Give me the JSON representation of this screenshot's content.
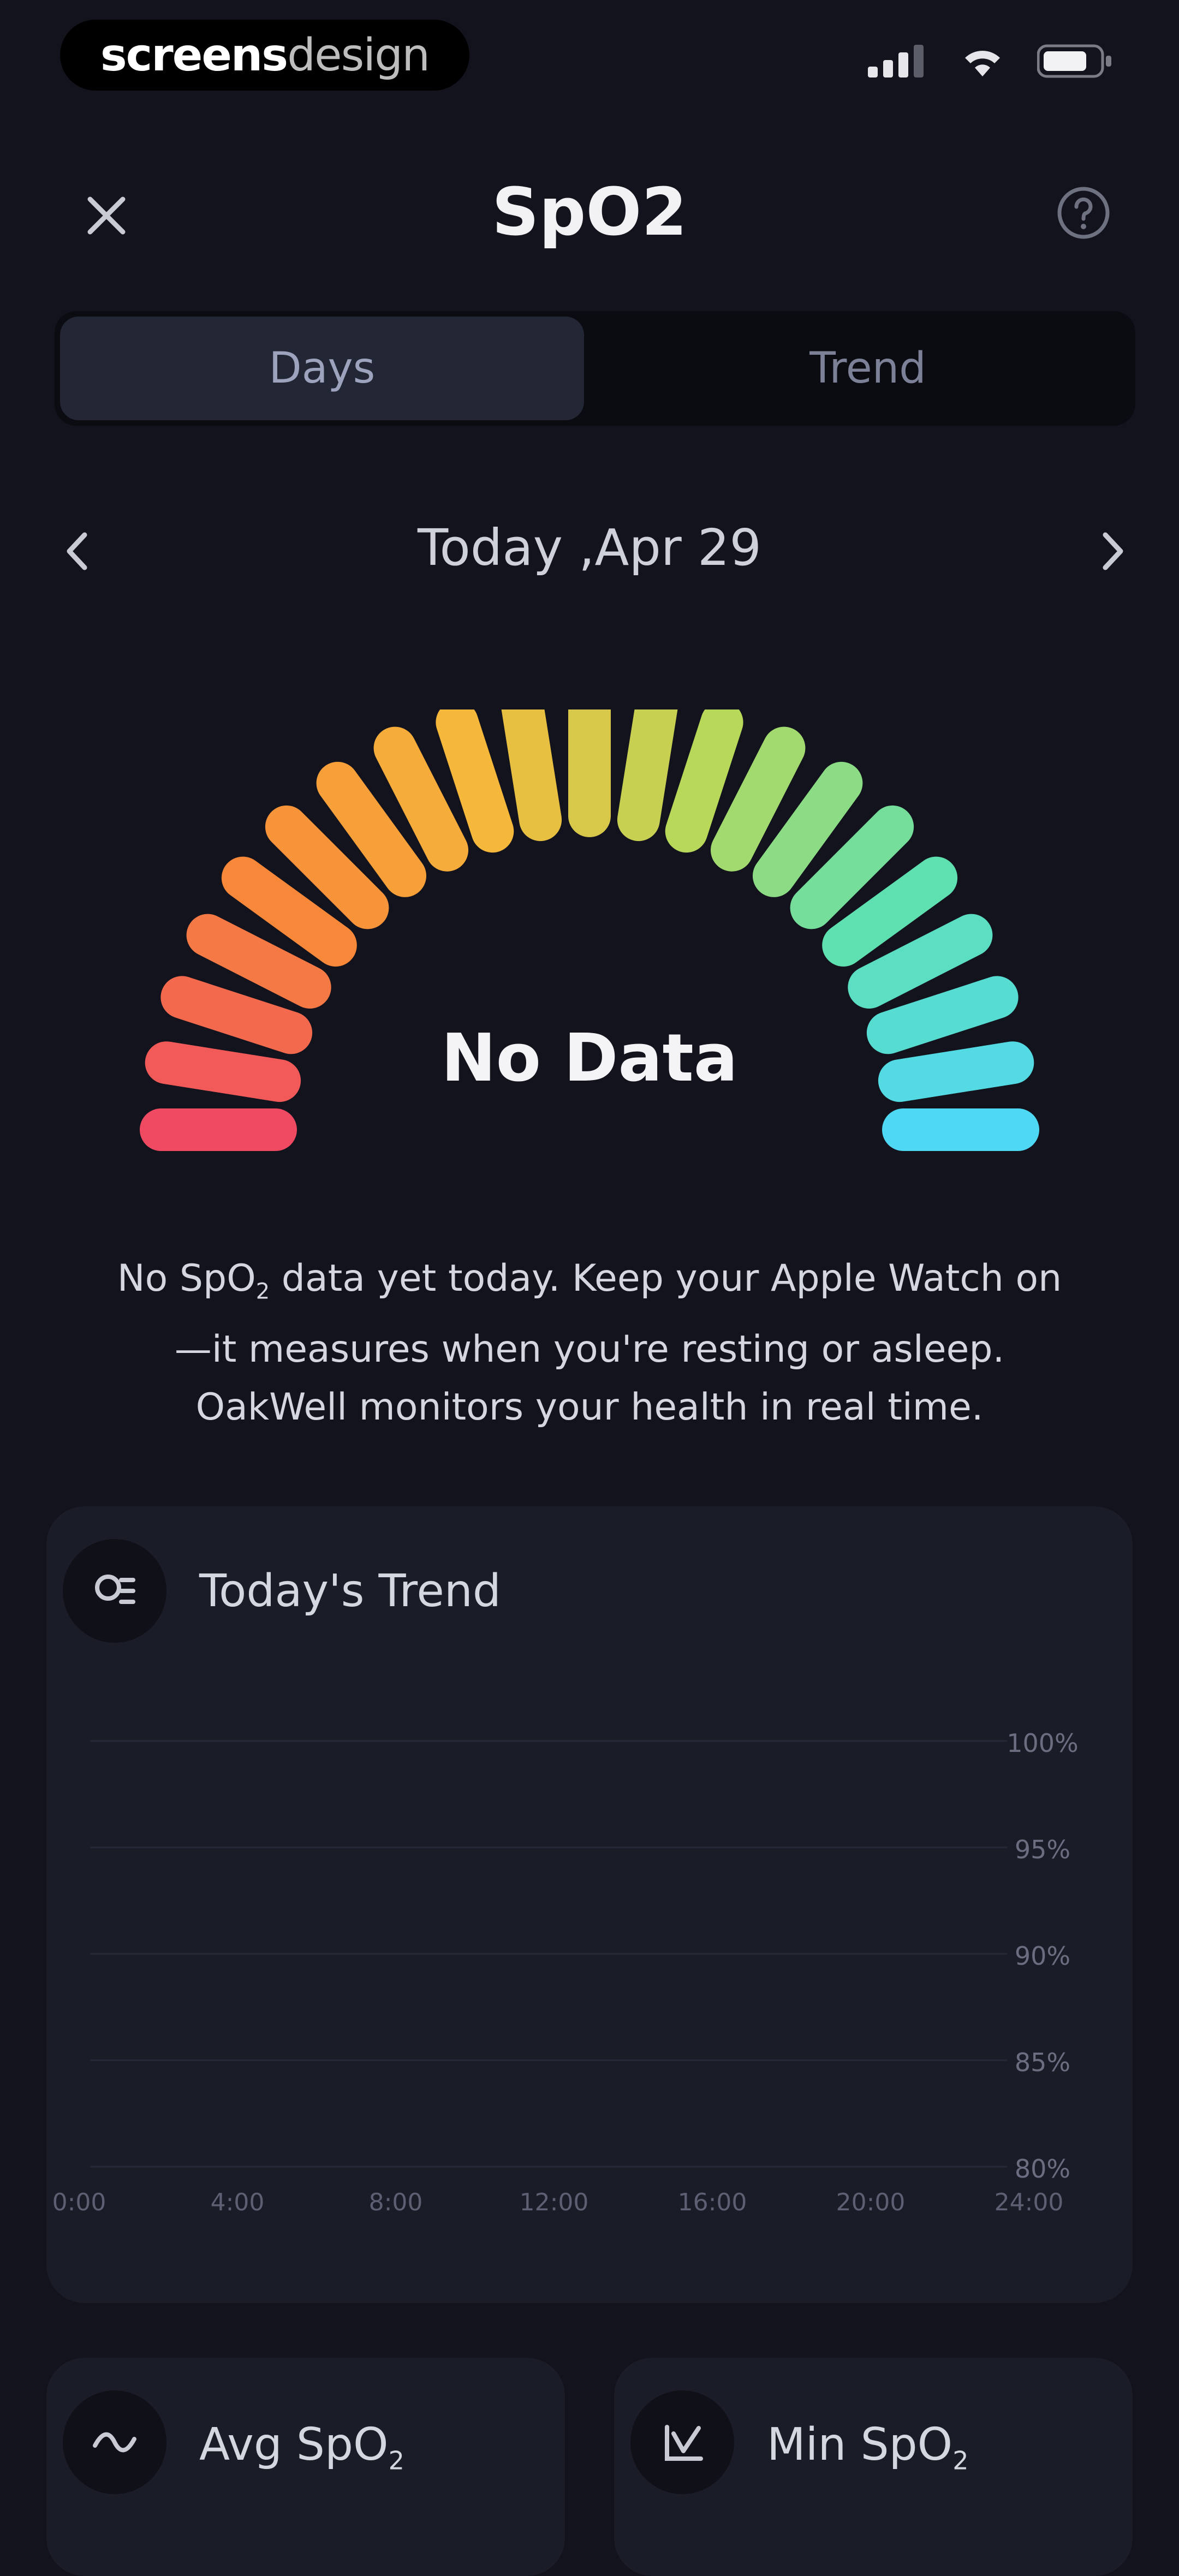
{
  "status_bar": {
    "brand_bold": "screens",
    "brand_light": "design"
  },
  "header": {
    "title": "SpO2",
    "close_icon": "close-icon",
    "help_icon": "help-icon"
  },
  "tabs": [
    {
      "label": "Days",
      "active": true
    },
    {
      "label": "Trend",
      "active": false
    }
  ],
  "date_nav": {
    "label": "Today ,Apr 29"
  },
  "gauge": {
    "label": "No Data",
    "colors": [
      "#ef4a62",
      "#f7883a",
      "#f6b83a",
      "#b8d85a",
      "#5fe0b0",
      "#4fd8f4"
    ]
  },
  "description": {
    "line1_a": "No SpO",
    "line1_sub": "2",
    "line1_b": " data yet today. Keep your Apple Watch on",
    "line2": "—it measures when you're resting or asleep.",
    "line3": "OakWell monitors your health in real time."
  },
  "trend_card": {
    "title": "Today's Trend",
    "icon": "trend-icon"
  },
  "chart_data": {
    "type": "line",
    "title": "Today's Trend",
    "x_ticks": [
      "0:00",
      "4:00",
      "8:00",
      "12:00",
      "16:00",
      "20:00",
      "24:00"
    ],
    "y_ticks": [
      "100%",
      "95%",
      "90%",
      "85%",
      "80%"
    ],
    "ylim": [
      80,
      100
    ],
    "series": [],
    "grid": true
  },
  "stats": [
    {
      "label_a": "Avg SpO",
      "label_sub": "2",
      "icon": "wave-icon"
    },
    {
      "label_a": "Min SpO",
      "label_sub": "2",
      "icon": "min-chart-icon"
    }
  ]
}
